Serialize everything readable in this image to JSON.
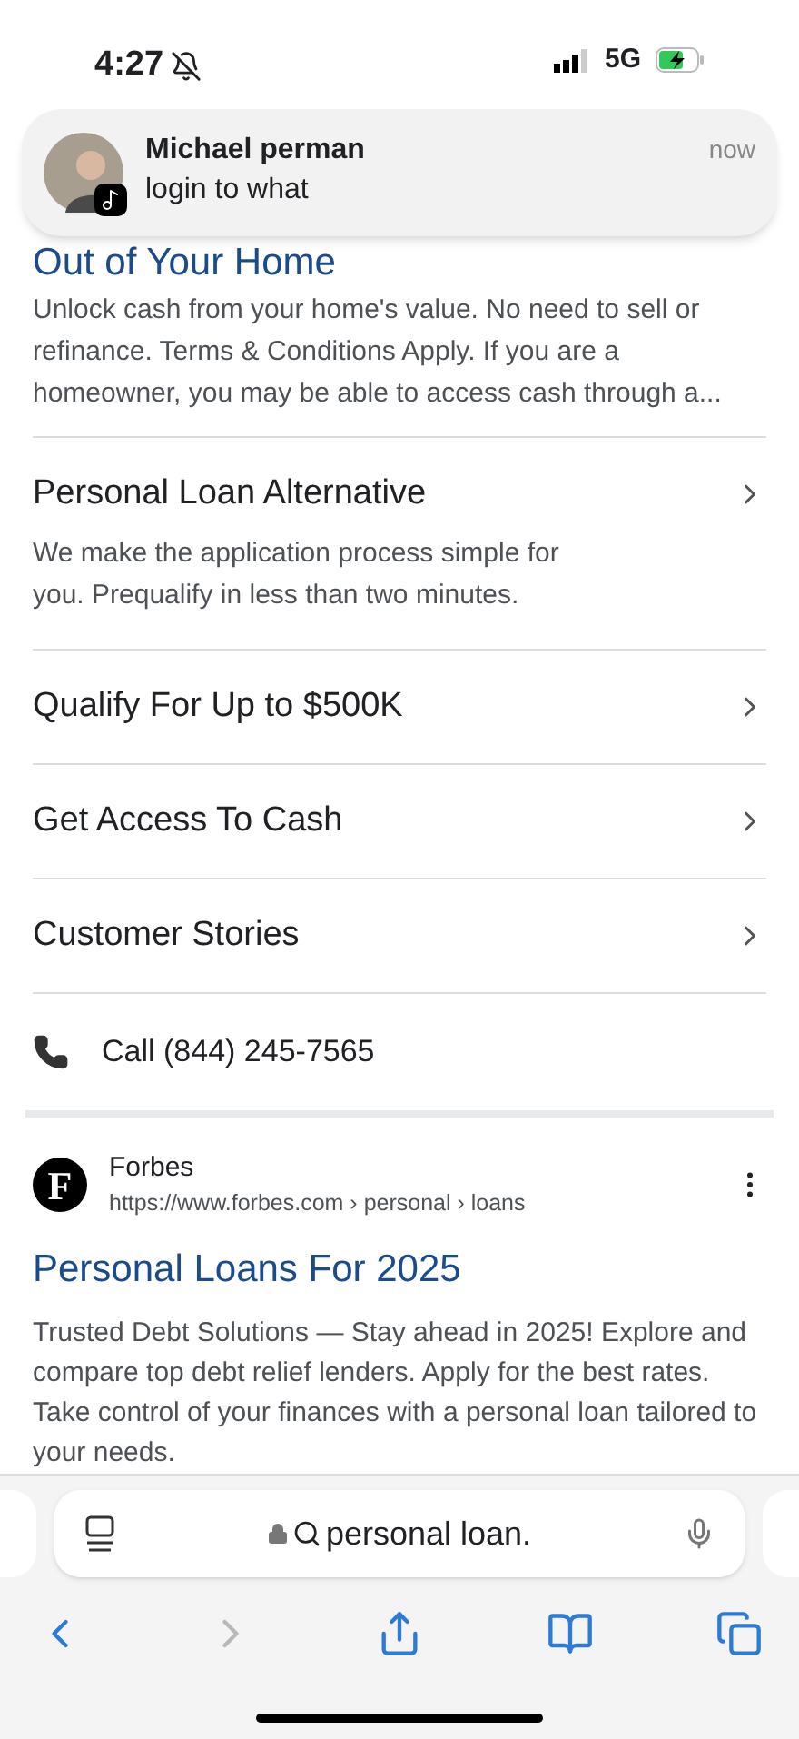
{
  "status_bar": {
    "time": "4:27",
    "network": "5G"
  },
  "notification": {
    "sender": "Michael perman",
    "message": "login to what",
    "time": "now"
  },
  "ad_result": {
    "title": "Out of Your Home",
    "description": "Unlock cash from your home's value. No need to sell or refinance. Terms & Conditions Apply. If you are a homeowner, you may be able to access cash through a...",
    "sitelinks": [
      {
        "title": "Personal Loan Alternative",
        "description": "We make the application process simple for you. Prequalify in less than two minutes."
      },
      {
        "title": "Qualify For Up to $500K"
      },
      {
        "title": "Get Access To Cash"
      },
      {
        "title": "Customer Stories"
      }
    ],
    "call": "Call (844) 245-7565"
  },
  "result": {
    "logo_letter": "F",
    "site": "Forbes",
    "url": "https://www.forbes.com › personal › loans",
    "title": "Personal Loans For 2025",
    "description": "Trusted Debt Solutions — Stay ahead in 2025! Explore and compare top debt relief lenders. Apply for the best rates. Take control of your finances with a personal loan tailored to your needs."
  },
  "address_bar": {
    "value": "personal loan."
  },
  "toolbar": [
    {
      "kind": "back",
      "disabled": false
    },
    {
      "kind": "forward",
      "disabled": true
    },
    {
      "kind": "share",
      "disabled": false
    },
    {
      "kind": "bookmarks",
      "disabled": false
    },
    {
      "kind": "tabs",
      "disabled": false
    }
  ]
}
